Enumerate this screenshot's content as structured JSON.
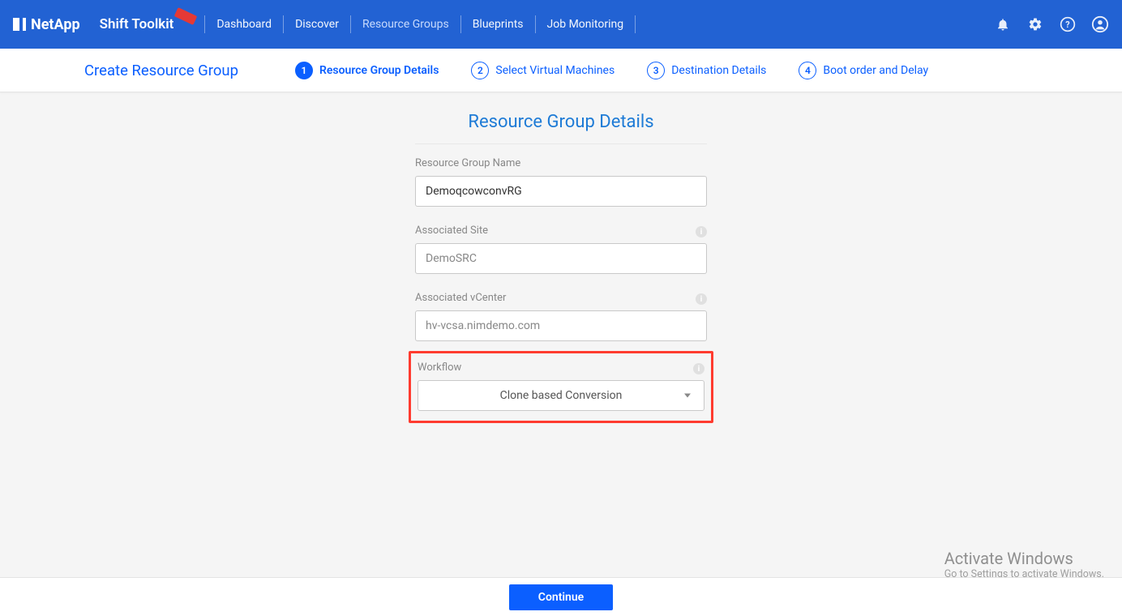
{
  "brand": {
    "company": "NetApp",
    "app": "Shift Toolkit"
  },
  "nav": {
    "items": [
      {
        "label": "Dashboard"
      },
      {
        "label": "Discover"
      },
      {
        "label": "Resource Groups"
      },
      {
        "label": "Blueprints"
      },
      {
        "label": "Job Monitoring"
      }
    ],
    "active_index": 2
  },
  "wizard": {
    "title": "Create Resource Group",
    "steps": [
      {
        "num": "1",
        "label": "Resource Group Details"
      },
      {
        "num": "2",
        "label": "Select Virtual Machines"
      },
      {
        "num": "3",
        "label": "Destination Details"
      },
      {
        "num": "4",
        "label": "Boot order and Delay"
      }
    ],
    "active_step": 0
  },
  "panel": {
    "heading": "Resource Group Details",
    "fields": {
      "name_label": "Resource Group Name",
      "name_value": "DemoqcowconvRG",
      "site_label": "Associated Site",
      "site_value": "DemoSRC",
      "vcenter_label": "Associated vCenter",
      "vcenter_value": "hv-vcsa.nimdemo.com",
      "workflow_label": "Workflow",
      "workflow_value": "Clone based Conversion"
    }
  },
  "footer": {
    "continue": "Continue"
  },
  "watermark": {
    "line1": "Activate Windows",
    "line2": "Go to Settings to activate Windows."
  }
}
